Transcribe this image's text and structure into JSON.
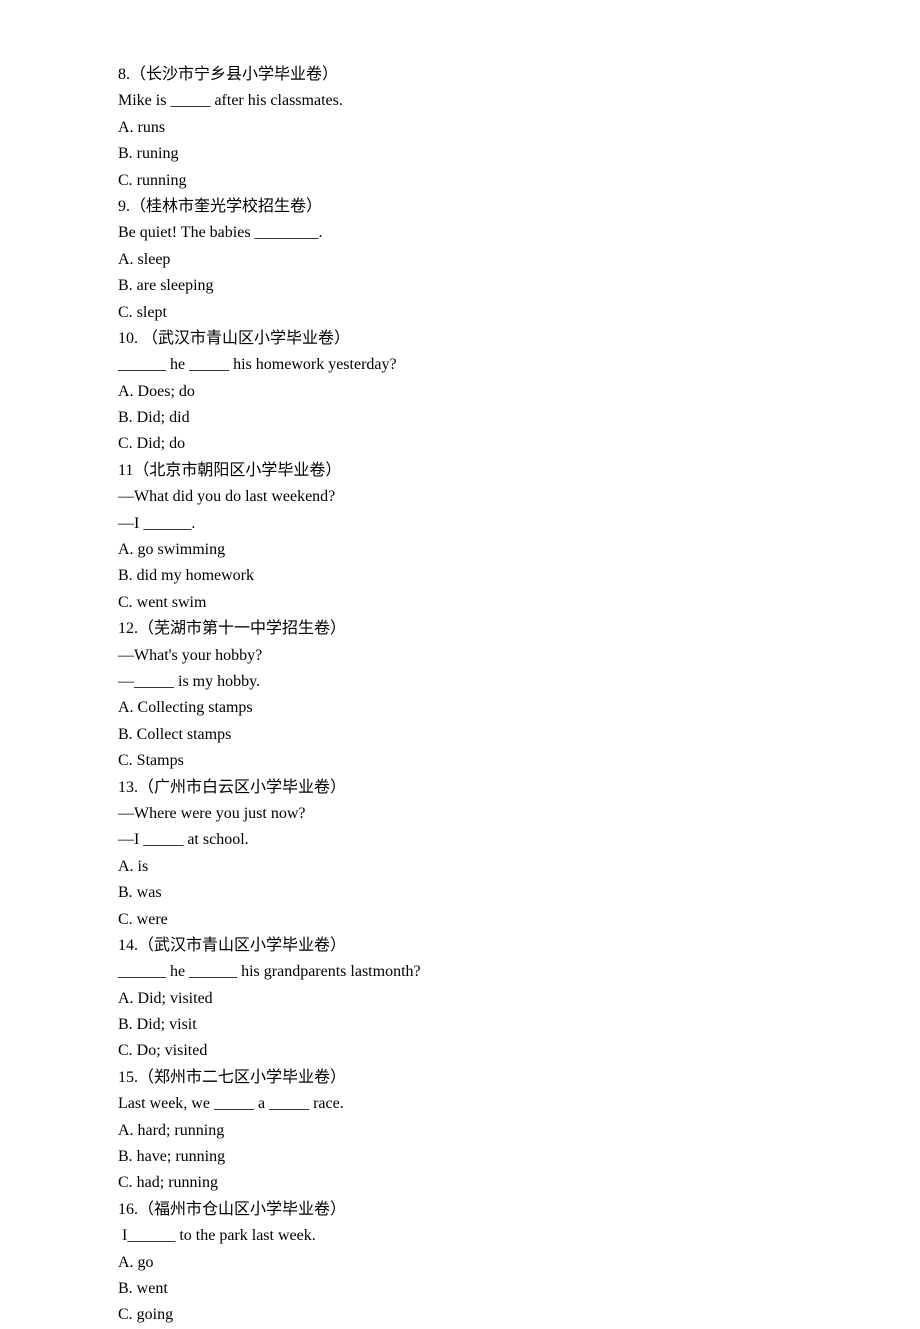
{
  "questions": [
    {
      "header": "8.（长沙市宁乡县小学毕业卷）",
      "stem": [
        "Mike is _____ after his classmates."
      ],
      "options": [
        "A. runs",
        "B. runing",
        "C. running"
      ]
    },
    {
      "header": "9.（桂林市奎光学校招生卷）",
      "stem": [
        "Be quiet! The babies ________."
      ],
      "options": [
        "A. sleep",
        "B. are sleeping",
        "C. slept"
      ]
    },
    {
      "header": "10. （武汉市青山区小学毕业卷）",
      "stem": [
        "______ he _____ his homework yesterday?"
      ],
      "options": [
        "A. Does; do",
        "B. Did; did",
        "C. Did; do"
      ]
    },
    {
      "header": "11（北京市朝阳区小学毕业卷）",
      "stem": [
        "—What did you do last weekend?",
        "—I ______."
      ],
      "options": [
        "A. go swimming",
        "B. did my homework",
        "C. went swim"
      ]
    },
    {
      "header": "12.（芜湖市第十一中学招生卷）",
      "stem": [
        "—What's your hobby?",
        "—_____ is my hobby."
      ],
      "options": [
        "A. Collecting stamps",
        "B. Collect stamps",
        "C. Stamps"
      ]
    },
    {
      "header": "13.（广州市白云区小学毕业卷）",
      "stem": [
        "—Where were you just now?",
        "—I _____ at school."
      ],
      "options": [
        "A. is",
        "B. was",
        "C. were"
      ]
    },
    {
      "header": "14.（武汉市青山区小学毕业卷）",
      "stem": [
        "______ he ______ his grandparents lastmonth?"
      ],
      "options": [
        "A. Did; visited",
        "B. Did; visit",
        "C. Do; visited"
      ]
    },
    {
      "header": "15.（郑州市二七区小学毕业卷）",
      "stem": [
        "Last week, we _____ a _____ race."
      ],
      "options": [
        "A. hard; running",
        "B. have; running",
        "C. had; running"
      ]
    },
    {
      "header": "16.（福州市仓山区小学毕业卷）",
      "stem": [
        " I______ to the park last week."
      ],
      "options": [
        "A. go",
        "B. went",
        "C. going"
      ]
    }
  ]
}
